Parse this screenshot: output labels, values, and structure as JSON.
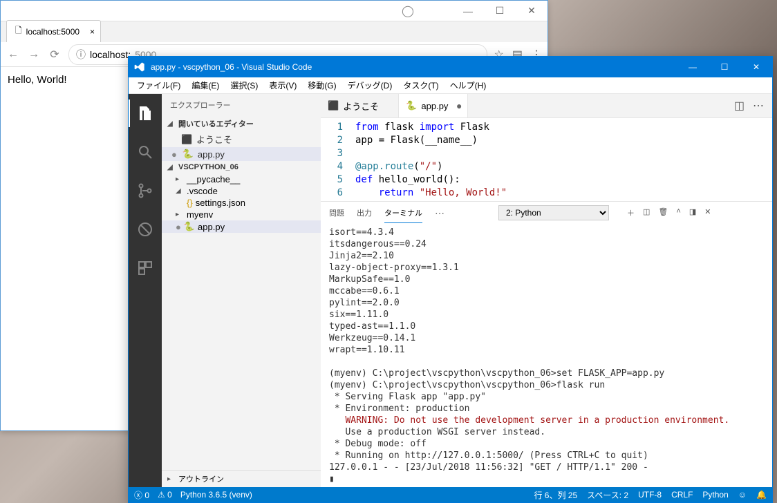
{
  "chrome": {
    "tab_title": "localhost:5000",
    "url_host": "localhost:",
    "url_port": "5000",
    "page_text": "Hello, World!"
  },
  "vscode": {
    "title": "app.py - vscpython_06 - Visual Studio Code",
    "menu": {
      "file": "ファイル(F)",
      "edit": "編集(E)",
      "select": "選択(S)",
      "view": "表示(V)",
      "go": "移動(G)",
      "debug": "デバッグ(D)",
      "task": "タスク(T)",
      "help": "ヘルプ(H)"
    },
    "sidebar": {
      "title": "エクスプローラー",
      "open_editors": "開いているエディター",
      "welcome": "ようこそ",
      "app_py": "app.py",
      "project": "VSCPYTHON_06",
      "pycache": "__pycache__",
      "vscode_folder": ".vscode",
      "settings": "settings.json",
      "myenv": "myenv",
      "approot": "app.py",
      "outline": "アウトライン"
    },
    "tabs": {
      "welcome": "ようこそ",
      "app": "app.py"
    },
    "code": {
      "l1a": "from",
      "l1b": " flask ",
      "l1c": "import",
      "l1d": " Flask",
      "l2": "app = Flask(__name__)",
      "l4": "@app.route",
      "l4b": "(",
      "l4c": "\"/\"",
      "l4d": ")",
      "l5a": "def",
      "l5b": " hello_world():",
      "l6a": "    return ",
      "l6b": "\"Hello, World!\""
    },
    "panel": {
      "problems": "問題",
      "output": "出力",
      "terminal": "ターミナル",
      "selector": "2: Python"
    },
    "terminal": {
      "l1": "isort==4.3.4",
      "l2": "itsdangerous==0.24",
      "l3": "Jinja2==2.10",
      "l4": "lazy-object-proxy==1.3.1",
      "l5": "MarkupSafe==1.0",
      "l6": "mccabe==0.6.1",
      "l7": "pylint==2.0.0",
      "l8": "six==1.11.0",
      "l9": "typed-ast==1.1.0",
      "l10": "Werkzeug==0.14.1",
      "l11": "wrapt==1.10.11",
      "l12": "",
      "l13": "(myenv) C:\\project\\vscpython\\vscpython_06>set FLASK_APP=app.py",
      "l14": "(myenv) C:\\project\\vscpython\\vscpython_06>flask run",
      "l15": " * Serving Flask app \"app.py\"",
      "l16": " * Environment: production",
      "l17": "   WARNING: Do not use the development server in a production environment.",
      "l18": "   Use a production WSGI server instead.",
      "l19": " * Debug mode: off",
      "l20": " * Running on http://127.0.0.1:5000/ (Press CTRL+C to quit)",
      "l21": "127.0.0.1 - - [23/Jul/2018 11:56:32] \"GET / HTTP/1.1\" 200 -",
      "l22": "▮"
    },
    "status": {
      "errors": "0",
      "warnings": "0",
      "python": "Python 3.6.5 (venv)",
      "lncol": "行 6、列 25",
      "spaces": "スペース: 2",
      "encoding": "UTF-8",
      "eol": "CRLF",
      "lang": "Python"
    }
  }
}
